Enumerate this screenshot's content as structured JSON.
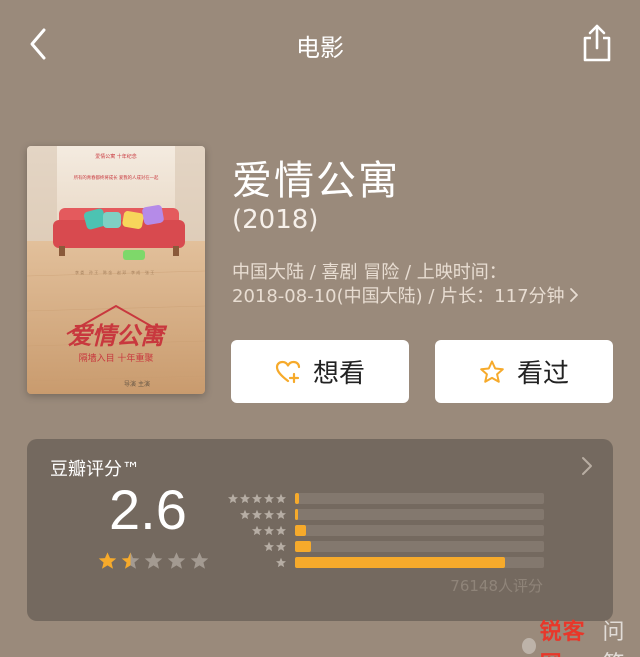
{
  "nav": {
    "title": "电影"
  },
  "movie": {
    "title": "爱情公寓",
    "year": "(2018)",
    "meta_line1": "中国大陆 / 喜剧 冒险 / 上映时间：",
    "meta_line2": "2018-08-10(中国大陆) / 片长：117分钟",
    "poster": {
      "tagline": "所有的青春都终将成长    爱我的人成对在一起",
      "title_art": "爱情公寓",
      "subtitle_art": "隔墙入目 十年重聚",
      "small_top": "爱情公寓 十年纪念",
      "credits": "导演  主演",
      "colors": {
        "wall": "#efe3d4",
        "floor": "#d9b38a",
        "sofa": "#e45a5d",
        "title": "#c8383e"
      }
    }
  },
  "actions": {
    "want_label": "想看",
    "seen_label": "看过"
  },
  "rating": {
    "label": "豆瓣评分™",
    "score": "2.6",
    "score_stars": 1.5,
    "distribution": [
      {
        "stars": 5,
        "value": 0.018
      },
      {
        "stars": 4,
        "value": 0.012
      },
      {
        "stars": 3,
        "value": 0.045
      },
      {
        "stars": 2,
        "value": 0.065
      },
      {
        "stars": 1,
        "value": 0.845
      }
    ],
    "votes": "76148人评分"
  },
  "watermark": {
    "red_text": "锐客网",
    "grey_text": "问答"
  },
  "colors": {
    "accent": "#f6aa2b",
    "background": "#9a8a7b",
    "card": "#74695f"
  }
}
